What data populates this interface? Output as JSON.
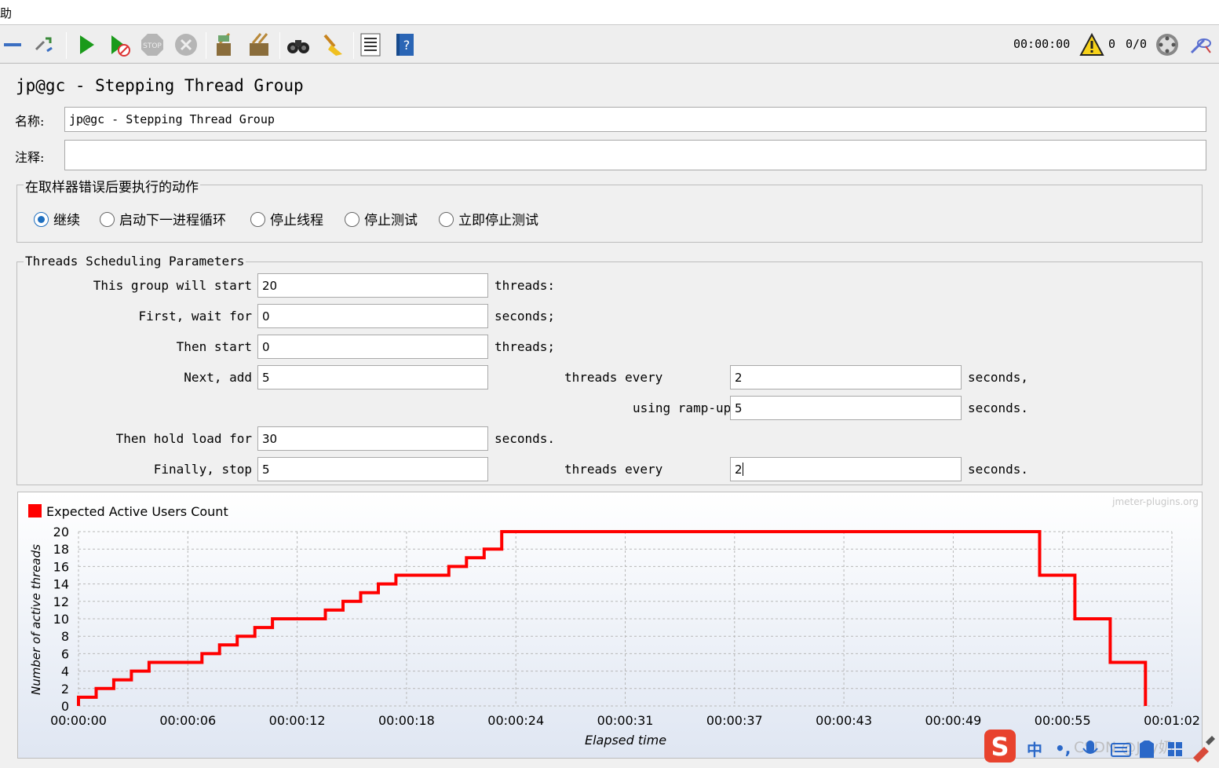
{
  "menu": {
    "partial_label": "助"
  },
  "toolbar": {
    "timer": "00:00:00",
    "warnings": "0",
    "threads": "0/0",
    "icons": [
      "collapse-icon",
      "toggle-icon",
      "start-icon",
      "start-no-pause-icon",
      "stop-icon",
      "shutdown-icon",
      "clear-icon",
      "clear-all-icon",
      "search-icon",
      "reset-search-icon",
      "function-helper-icon",
      "help-icon",
      "warning-icon",
      "remote-icon",
      "log-icon"
    ]
  },
  "panel": {
    "title": "jp@gc - Stepping Thread Group"
  },
  "name_field": {
    "label": "名称:",
    "value": "jp@gc - Stepping Thread Group"
  },
  "comment_field": {
    "label": "注释:",
    "value": ""
  },
  "error_action": {
    "legend": "在取样器错误后要执行的动作",
    "options": [
      "继续",
      "启动下一进程循环",
      "停止线程",
      "停止测试",
      "立即停止测试"
    ],
    "selected": "继续"
  },
  "params": {
    "legend": "Threads Scheduling Parameters",
    "start_label": "This group will start",
    "start_value": "20",
    "start_unit": "threads:",
    "wait_label": "First, wait for",
    "wait_value": "0",
    "wait_unit": "seconds;",
    "then_start_label": "Then start",
    "then_start_value": "0",
    "then_start_unit": "threads;",
    "next_add_label": "Next, add",
    "next_add_value": "5",
    "next_add_mid": "threads every",
    "next_add_every": "2",
    "next_add_unit": "seconds,",
    "rampup_label": "using ramp-up",
    "rampup_value": "5",
    "rampup_unit": "seconds.",
    "hold_label": "Then hold load for",
    "hold_value": "30",
    "hold_unit": "seconds.",
    "stop_label": "Finally, stop",
    "stop_value": "5",
    "stop_mid": "threads every",
    "stop_every": "2",
    "stop_unit": "seconds."
  },
  "chart_data": {
    "type": "line",
    "watermark": "jmeter-plugins.org",
    "legend": "Expected Active Users Count",
    "xlabel": "Elapsed time",
    "ylabel": "Number of active threads",
    "ylim": [
      0,
      20
    ],
    "yticks": [
      "0",
      "2",
      "4",
      "6",
      "8",
      "10",
      "12",
      "14",
      "16",
      "18",
      "20"
    ],
    "xticks": [
      "00:00:00",
      "00:00:06",
      "00:00:12",
      "00:00:18",
      "00:00:24",
      "00:00:31",
      "00:00:37",
      "00:00:43",
      "00:00:49",
      "00:00:55",
      "00:01:02"
    ],
    "xlim_seconds": [
      0,
      62
    ],
    "grid": true,
    "color": "#ff0000",
    "series": [
      {
        "name": "Expected Active Users Count",
        "x_seconds": [
          0,
          0,
          1,
          1,
          2,
          2,
          3,
          3,
          4,
          4,
          7,
          7,
          8,
          8,
          9,
          9,
          10,
          10,
          11,
          11,
          14,
          14,
          15,
          15,
          16,
          16,
          17,
          17,
          18,
          18,
          21,
          21,
          22,
          22,
          23,
          23,
          24,
          24,
          54.5,
          54.5,
          56.5,
          56.5,
          58.5,
          58.5,
          60.5,
          60.5
        ],
        "y": [
          0,
          1,
          1,
          2,
          2,
          3,
          3,
          4,
          4,
          5,
          5,
          6,
          6,
          7,
          7,
          8,
          8,
          9,
          9,
          10,
          10,
          11,
          11,
          12,
          12,
          13,
          13,
          14,
          14,
          15,
          15,
          16,
          16,
          17,
          17,
          18,
          18,
          20,
          20,
          15,
          15,
          10,
          10,
          5,
          5,
          0
        ]
      }
    ]
  },
  "ime_bar": {
    "ime_label": "中",
    "punct": "•,",
    "watermark": "CSDN @Jay奶"
  }
}
